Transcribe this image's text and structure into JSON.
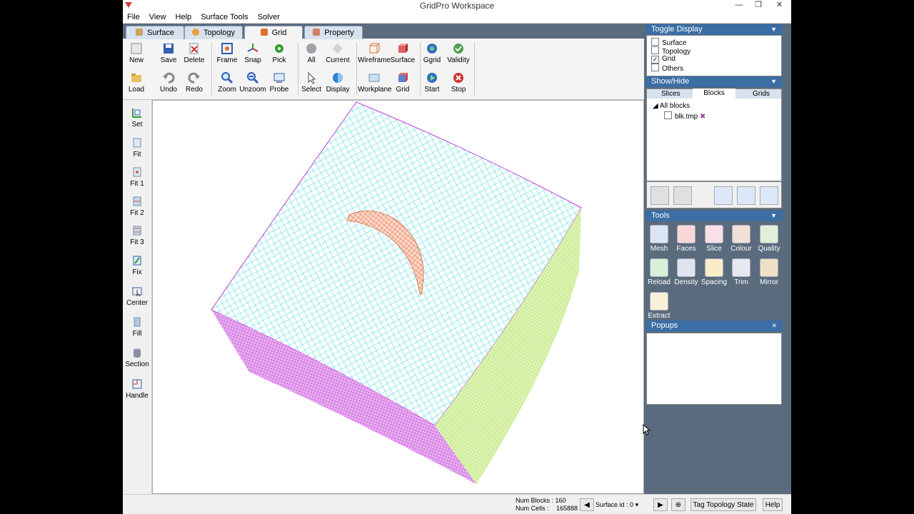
{
  "window": {
    "title": "GridPro Workspace",
    "minimize": "—",
    "restore": "❐",
    "close": "✕"
  },
  "menu": [
    "File",
    "View",
    "Help",
    "Surface Tools",
    "Solver"
  ],
  "tabs": [
    {
      "label": "Surface",
      "color": "#c8a060"
    },
    {
      "label": "Topology",
      "color": "#e0a040"
    },
    {
      "label": "Grid",
      "color": "#e07030"
    },
    {
      "label": "Property",
      "color": "#d08060"
    }
  ],
  "toolbar": {
    "new": "New",
    "load": "Load",
    "save": "Save",
    "undo": "Undo",
    "delete": "Delete",
    "redo": "Redo",
    "frame": "Frame",
    "zoom": "Zoom",
    "snap": "Snap",
    "unzoom": "Unzoom",
    "pick": "Pick",
    "probe": "Probe",
    "all": "All",
    "select": "Select",
    "current": "Current",
    "display": "Display",
    "wireframe": "Wireframe",
    "workplane": "Workplane",
    "surface": "Surface",
    "grid": "Grid",
    "ggrid": "Ggrid",
    "start": "Start",
    "validity": "Validity",
    "stop": "Stop"
  },
  "left_tools": [
    "Set",
    "Fit",
    "Fit 1",
    "Fit 2",
    "Fit 3",
    "Fix",
    "Center",
    "Fill",
    "Section",
    "Handle"
  ],
  "toggle_display": {
    "title": "Toggle Display",
    "items": [
      {
        "label": "Surface",
        "checked": false
      },
      {
        "label": "Topology",
        "checked": false
      },
      {
        "label": "Grid",
        "checked": true
      },
      {
        "label": "Others",
        "checked": false
      }
    ]
  },
  "show_hide": {
    "title": "Show/Hide",
    "tabs": [
      "Slices",
      "Blocks",
      "Grids"
    ],
    "active_tab": "Blocks",
    "root": "All blocks",
    "item": "blk.tmp"
  },
  "tools": {
    "title": "Tools",
    "items": [
      "Mesh",
      "Faces",
      "Slice",
      "Colour",
      "Quality",
      "Reload",
      "Density",
      "Spacing",
      "Trim",
      "Mirror",
      "Extract"
    ]
  },
  "popups": {
    "title": "Popups",
    "close": "✕"
  },
  "status": {
    "num_blocks_label": "Num Blocks :",
    "num_blocks": "160",
    "num_cells_label": "Num Cells :",
    "num_cells": "165888",
    "surface_id_label": "Surface id :",
    "surface_id": "0",
    "tag_state": "Tag Topology State",
    "help": "Help"
  },
  "colors": {
    "top_face": "#40d8d8",
    "left_face": "#c040d8",
    "right_face": "#a8e040",
    "airfoil": "#e06840",
    "panel_bg": "#5a6b7d",
    "header": "#3a6ea5"
  }
}
